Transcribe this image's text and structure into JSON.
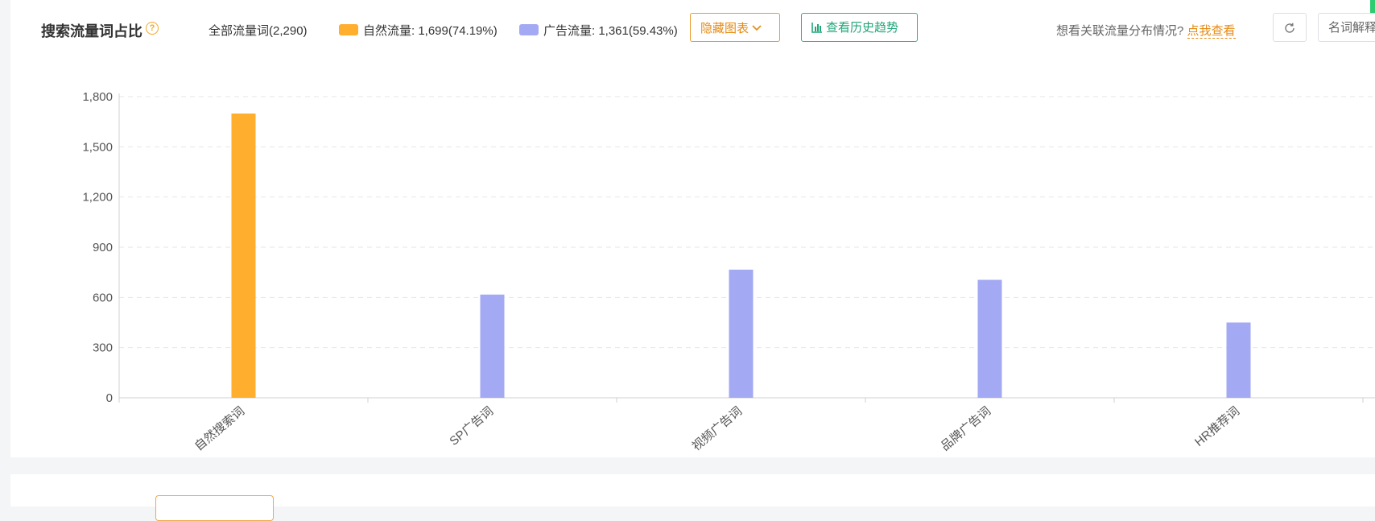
{
  "header": {
    "title": "搜索流量词占比",
    "help_icon": "question-circle-icon",
    "legend_all": "全部流量词(2,290)",
    "legend_natural": "自然流量: 1,699(74.19%)",
    "legend_ad": "广告流量: 1,361(59.43%)",
    "hide_chart_label": "隐藏图表",
    "history_label": "查看历史趋势",
    "hint_text": "想看关联流量分布情况?",
    "hint_link": "点我查看",
    "refresh_icon": "refresh-icon",
    "glossary_label": "名词解释"
  },
  "colors": {
    "natural": "#ffae2d",
    "ad": "#a3a9f3",
    "accent_orange": "#e58a12",
    "accent_green": "#21a67a"
  },
  "chart_data": {
    "type": "bar",
    "categories": [
      "自然搜索词",
      "SP广告词",
      "视频广告词",
      "品牌广告词",
      "HR推荐词"
    ],
    "values": [
      1699,
      617,
      766,
      705,
      450
    ],
    "bar_colors": [
      "#ffae2d",
      "#a3a9f3",
      "#a3a9f3",
      "#a3a9f3",
      "#a3a9f3"
    ],
    "yticks": [
      "0",
      "300",
      "600",
      "900",
      "1,200",
      "1,500",
      "1,800"
    ],
    "ylim": [
      0,
      1800
    ],
    "grid": true,
    "xlabel": "",
    "ylabel": ""
  }
}
